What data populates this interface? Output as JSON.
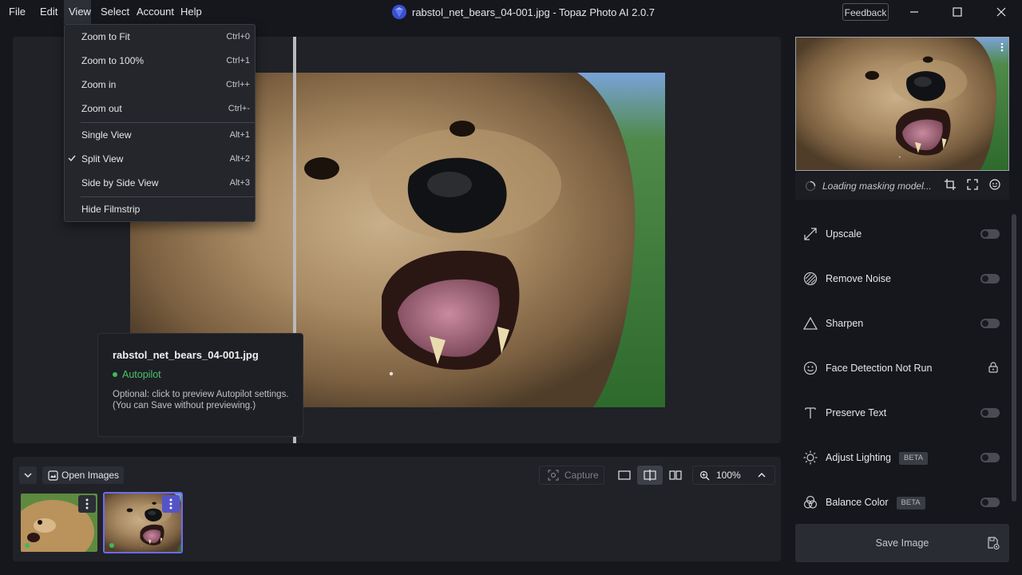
{
  "menu": {
    "file": "File",
    "edit": "Edit",
    "view": "View",
    "select": "Select",
    "account": "Account",
    "help": "Help"
  },
  "window": {
    "title": "rabstol_net_bears_04-001.jpg - Topaz Photo AI 2.0.7",
    "feedback_label": "Feedback"
  },
  "view_menu": {
    "items": [
      {
        "label": "Zoom to Fit",
        "shortcut": "Ctrl+0"
      },
      {
        "label": "Zoom to 100%",
        "shortcut": "Ctrl+1"
      },
      {
        "label": "Zoom in",
        "shortcut": "Ctrl++"
      },
      {
        "label": "Zoom out",
        "shortcut": "Ctrl+-"
      },
      {
        "label": "Single View",
        "shortcut": "Alt+1"
      },
      {
        "label": "Split View",
        "shortcut": "Alt+2",
        "checked": true
      },
      {
        "label": "Side by Side View",
        "shortcut": "Alt+3"
      },
      {
        "label": "Hide Filmstrip",
        "shortcut": ""
      }
    ]
  },
  "autopilot_popup": {
    "filename": "rabstol_net_bears_04-001.jpg",
    "status": "Autopilot",
    "status_color": "#3fb85d",
    "description_line1": "Optional: click to preview Autopilot settings.",
    "description_line2": "(You can Save without previewing.)"
  },
  "filmstrip": {
    "open_images_label": "Open Images",
    "capture_label": "Capture",
    "zoom_level": "100%",
    "active_view_mode": "split",
    "selected_thumbnail": 2,
    "accent_color": "#6c6cf2"
  },
  "right_panel": {
    "loading_text": "Loading masking model...",
    "tools": [
      {
        "label": "Upscale",
        "icon": "upscale-icon",
        "enabled": false
      },
      {
        "label": "Remove Noise",
        "icon": "remove-noise-icon",
        "enabled": false
      },
      {
        "label": "Sharpen",
        "icon": "sharpen-icon",
        "enabled": false
      },
      {
        "label": "Face Detection Not Run",
        "icon": "face-icon",
        "locked": true
      },
      {
        "label": "Preserve Text",
        "icon": "text-icon",
        "enabled": false
      },
      {
        "label": "Adjust Lighting",
        "icon": "sun-icon",
        "badge": "BETA",
        "enabled": false
      },
      {
        "label": "Balance Color",
        "icon": "color-balance-icon",
        "badge": "BETA",
        "enabled": false
      }
    ],
    "save_label": "Save Image"
  }
}
